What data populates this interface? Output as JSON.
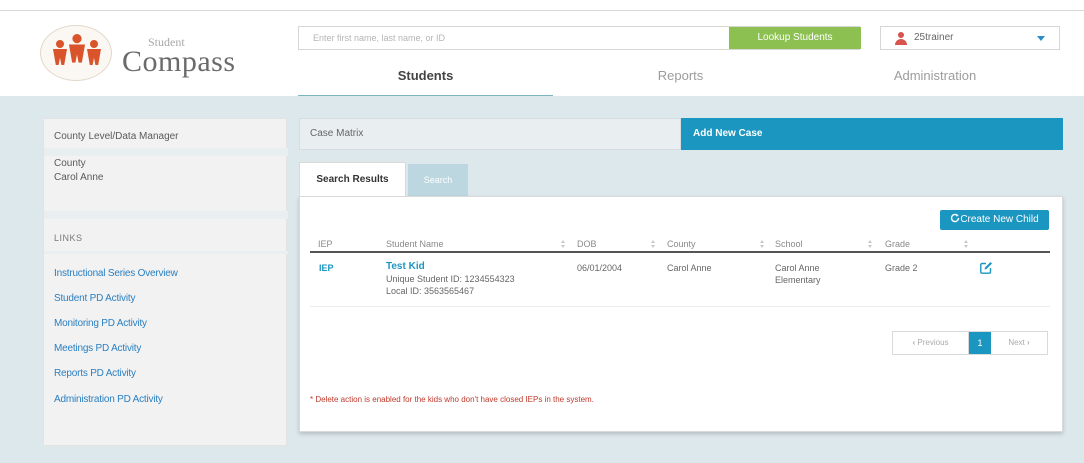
{
  "header": {
    "logo_small": "Student",
    "logo_big": "Compass",
    "search_placeholder": "Enter first name, last name, or ID",
    "lookup_button": "Lookup Students",
    "username": "25trainer"
  },
  "nav": {
    "tabs": [
      {
        "label": "Students",
        "active": true
      },
      {
        "label": "Reports",
        "active": false
      },
      {
        "label": "Administration",
        "active": false
      }
    ]
  },
  "sidebar": {
    "role": "County Level/Data Manager",
    "county_label": "County",
    "county_value": "Carol Anne",
    "links_heading": "LINKS",
    "links": [
      "Instructional Series Overview",
      "Student PD Activity",
      "Monitoring PD Activity",
      "Meetings PD Activity",
      "Reports PD Activity",
      "Administration PD Activity"
    ]
  },
  "content": {
    "case_matrix": "Case Matrix",
    "add_new_case": "Add New Case",
    "tabs": [
      "Search Results",
      "Search"
    ],
    "create_button": "Create New Child",
    "columns": [
      "IEP",
      "Student Name",
      "DOB",
      "County",
      "School",
      "Grade"
    ],
    "rows": [
      {
        "iep": "IEP",
        "name": "Test Kid",
        "unique_id": "Unique Student ID: 1234554323",
        "local_id": "Local ID: 3563565467",
        "dob": "06/01/2004",
        "county": "Carol Anne",
        "school_line1": "Carol Anne",
        "school_line2": "Elementary",
        "grade": "Grade 2"
      }
    ],
    "pagination": {
      "previous": "Previous",
      "current": "1",
      "next": "Next"
    },
    "note": "* Delete action is enabled for the kids who don't have closed IEPs in the system."
  },
  "colors": {
    "accent": "#1b96c1",
    "lookup_green": "#8cc152",
    "link_blue": "#2a7fc1",
    "note_red": "#c0392b",
    "page_bg": "#dde8ec"
  },
  "icons": [
    "logo-family-icon",
    "user-icon",
    "caret-down-icon",
    "refresh-icon",
    "sort-icon",
    "edit-icon",
    "chevron-left-icon",
    "chevron-right-icon"
  ]
}
